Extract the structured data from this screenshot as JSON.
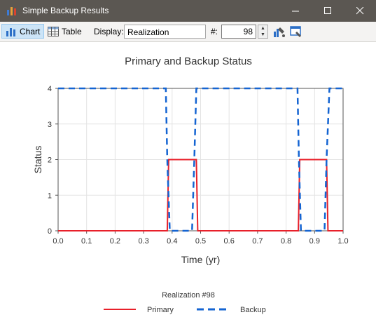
{
  "window": {
    "title": "Simple Backup Results"
  },
  "toolbar": {
    "chart_label": "Chart",
    "table_label": "Table",
    "display_label": "Display:",
    "display_value": "Realization",
    "hash_label": "#:",
    "realization_number": "98"
  },
  "colors": {
    "primary": "#e8202a",
    "backup": "#1464d2",
    "titlebar": "#5b5752",
    "active_button": "#cce4f7"
  },
  "chart_data": {
    "type": "line",
    "title": "Primary and Backup Status",
    "xlabel": "Time (yr)",
    "ylabel": "Status",
    "xlim": [
      0,
      1
    ],
    "ylim": [
      0,
      4
    ],
    "xticks": [
      "0.0",
      "0.1",
      "0.2",
      "0.3",
      "0.4",
      "0.5",
      "0.6",
      "0.7",
      "0.8",
      "0.9",
      "1.0"
    ],
    "yticks": [
      "0",
      "1",
      "2",
      "3",
      "4"
    ],
    "grid": true,
    "legend_title": "Realization #98",
    "legend_position": "bottom",
    "series": [
      {
        "name": "Primary",
        "style": "solid",
        "color": "#e8202a",
        "points": [
          [
            0,
            0
          ],
          [
            0.383,
            0
          ],
          [
            0.388,
            2
          ],
          [
            0.485,
            2
          ],
          [
            0.49,
            0
          ],
          [
            0.843,
            0
          ],
          [
            0.848,
            2
          ],
          [
            0.942,
            2
          ],
          [
            0.947,
            0
          ],
          [
            1.0,
            0
          ]
        ]
      },
      {
        "name": "Backup",
        "style": "dashed",
        "color": "#1464d2",
        "points": [
          [
            0,
            4
          ],
          [
            0.378,
            4
          ],
          [
            0.383,
            2
          ],
          [
            0.392,
            0
          ],
          [
            0.47,
            0
          ],
          [
            0.478,
            2
          ],
          [
            0.485,
            4
          ],
          [
            0.84,
            4
          ],
          [
            0.845,
            2
          ],
          [
            0.852,
            0
          ],
          [
            0.935,
            0
          ],
          [
            0.942,
            2
          ],
          [
            0.952,
            4
          ],
          [
            1.0,
            4
          ]
        ]
      }
    ]
  }
}
